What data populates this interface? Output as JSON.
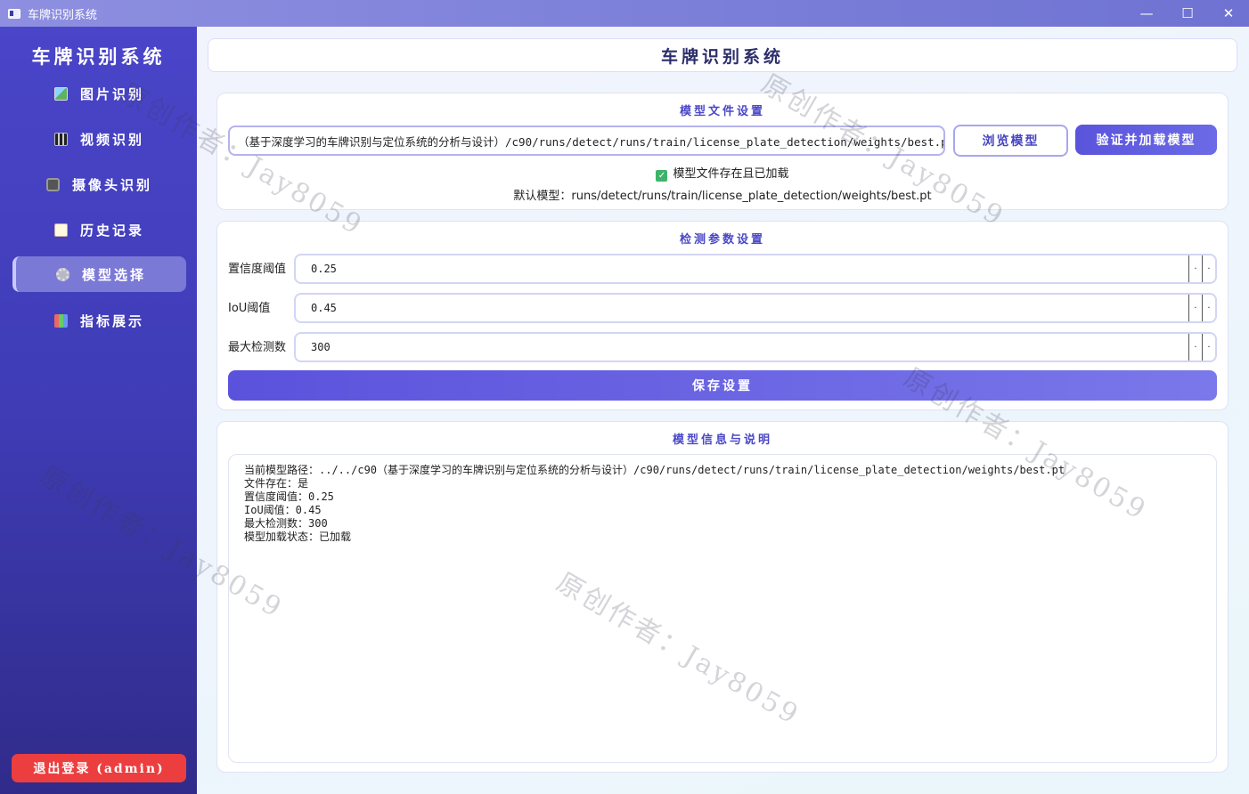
{
  "window": {
    "title": "车牌识别系统",
    "minimize": "—",
    "maximize": "☐",
    "close": "✕"
  },
  "sidebar": {
    "title": "车牌识别系统",
    "items": [
      {
        "label": "图片识别",
        "icon": "image-icon"
      },
      {
        "label": "视频识别",
        "icon": "video-icon"
      },
      {
        "label": "摄像头识别",
        "icon": "camera-icon"
      },
      {
        "label": "历史记录",
        "icon": "history-icon"
      },
      {
        "label": "模型选择",
        "icon": "gear-icon",
        "active": true
      },
      {
        "label": "指标展示",
        "icon": "chart-icon"
      }
    ],
    "logout": "退出登录 (admin)"
  },
  "header": {
    "title": "车牌识别系统"
  },
  "model_file": {
    "title": "模型文件设置",
    "path_value": "（基于深度学习的车牌识别与定位系统的分析与设计）/c90/runs/detect/runs/train/license_plate_detection/weights/best.pt",
    "browse_label": "浏览模型",
    "verify_label": "验证并加载模型",
    "status": "模型文件存在且已加载",
    "default_model": "默认模型：runs/detect/runs/train/license_plate_detection/weights/best.pt"
  },
  "params": {
    "title": "检测参数设置",
    "confidence_label": "置信度阈值",
    "confidence_value": "0.25",
    "iou_label": "IoU阈值",
    "iou_value": "0.45",
    "maxdet_label": "最大检测数",
    "maxdet_value": "300",
    "spin_up": "·",
    "spin_down": "·",
    "save_label": "保存设置"
  },
  "info": {
    "title": "模型信息与说明",
    "text": "当前模型路径：../../c90（基于深度学习的车牌识别与定位系统的分析与设计）/c90/runs/detect/runs/train/license_plate_detection/weights/best.pt\n文件存在：是\n置信度阈值：0.25\nIoU阈值：0.45\n最大检测数：300\n模型加载状态：已加载"
  },
  "watermark": "原创作者：Jay8059"
}
